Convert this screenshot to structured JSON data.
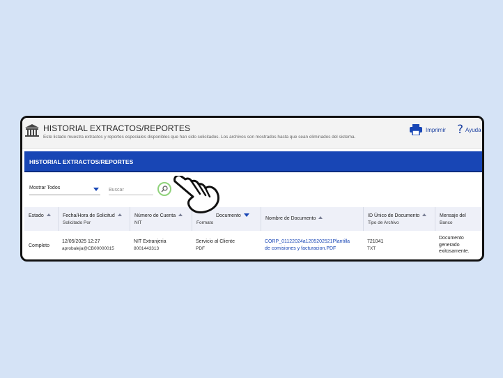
{
  "header": {
    "title": "HISTORIAL EXTRACTOS/REPORTES",
    "description": "Este listado muestra extractos y reportes especiales disponibles que han sido solicitados. Los archivos son mostrados hasta que sean eliminados del sistema.",
    "print_label": "Imprimir",
    "help_label": "Ayuda",
    "help_glyph": "?"
  },
  "section": {
    "title": "HISTORIAL EXTRACTOS/REPORTES"
  },
  "filters": {
    "show_selected": "Mostrar Todos",
    "search_placeholder": "Buscar"
  },
  "table": {
    "columns": [
      {
        "label": "Estado",
        "sub": ""
      },
      {
        "label": "Fecha/Hora de Solicitud",
        "sub": "Solicitado Por"
      },
      {
        "label": "Número de Cuenta",
        "sub": "NIT"
      },
      {
        "label": "Documento",
        "sub": "Formato"
      },
      {
        "label": "Nombre de Documento",
        "sub": ""
      },
      {
        "label": "ID Único de Documento",
        "sub": "Tipo de Archivo"
      },
      {
        "label": "Mensaje del",
        "sub": "Banco"
      }
    ],
    "rows": [
      {
        "estado": "Completo",
        "fecha": "12/05/2025 12:27",
        "solicitado_por": "aprobaleja@CB00000015",
        "cuenta": "NIT Extranjeria",
        "nit": "8001443313",
        "documento": "Servicio al Cliente",
        "formato": "PDF",
        "nombre_1": "CORP_01122024a1205202521Plantilla",
        "nombre_2": "de comisiones y facturacion.PDF",
        "id_unico": "721041",
        "tipo_archivo": "TXT",
        "mensaje_1": "Documento",
        "mensaje_2": "generado",
        "mensaje_3": "exitosamente."
      }
    ]
  },
  "colors": {
    "accent": "#1846b5",
    "background": "#d5e3f6",
    "search_highlight": "#8fd27a"
  },
  "icons": [
    "bank-icon",
    "printer-icon",
    "help-icon",
    "search-icon",
    "pointing-hand-icon"
  ]
}
